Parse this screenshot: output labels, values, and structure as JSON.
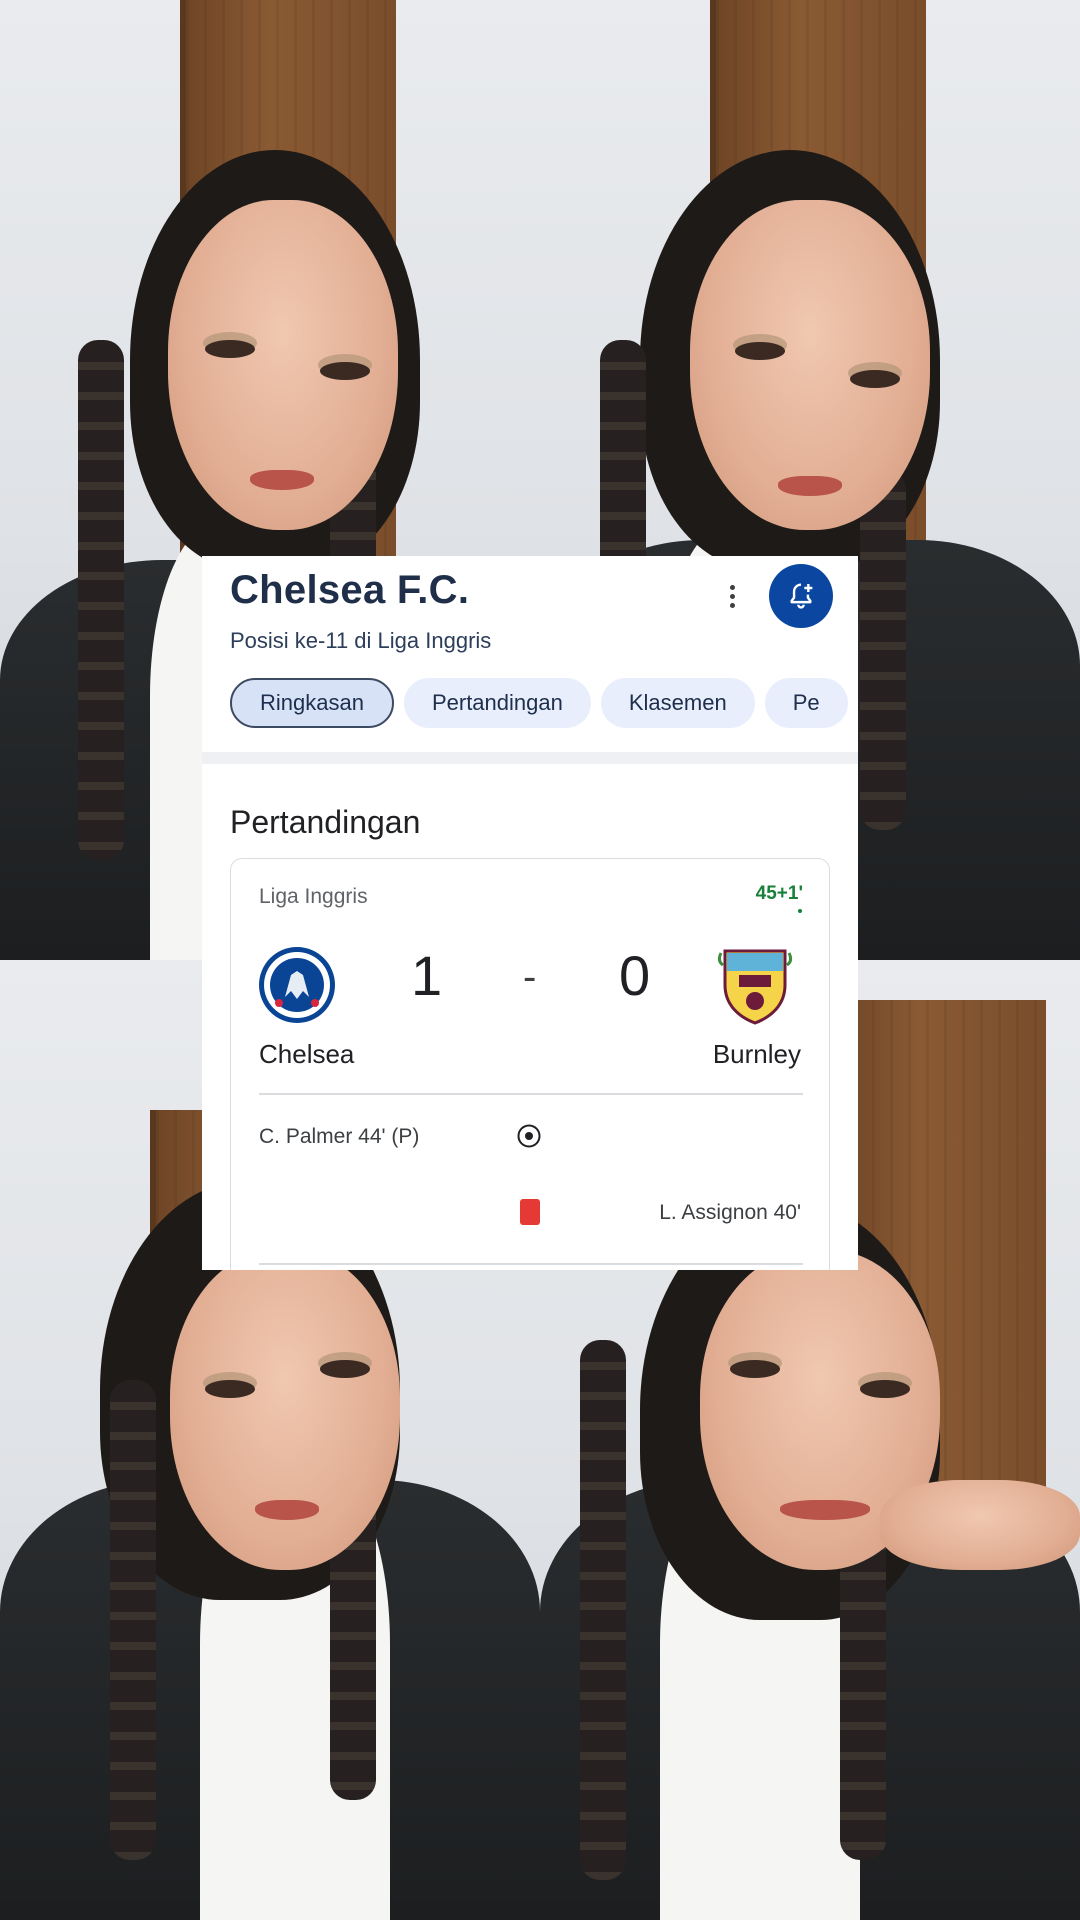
{
  "team_card": {
    "title": "Chelsea F.C.",
    "subtitle": "Posisi ke-11 di Liga Inggris",
    "menu_icon": "more-vert-icon",
    "follow_icon": "bell-plus-icon",
    "tabs": [
      {
        "label": "Ringkasan",
        "active": true
      },
      {
        "label": "Pertandingan",
        "active": false
      },
      {
        "label": "Klasemen",
        "active": false
      },
      {
        "label": "Pe",
        "active": false
      }
    ],
    "section_title": "Pertandingan",
    "match": {
      "league": "Liga Inggris",
      "minute": "45+1'",
      "home": {
        "name": "Chelsea",
        "score": "1",
        "crest_icon": "chelsea-crest-icon"
      },
      "away": {
        "name": "Burnley",
        "score": "0",
        "crest_icon": "burnley-crest-icon"
      },
      "separator": "-",
      "events": [
        {
          "side": "home",
          "text": "C. Palmer 44' (P)",
          "icon": "soccer-ball-icon"
        },
        {
          "side": "away",
          "text": "L. Assignon 40'",
          "icon": "red-card-icon"
        }
      ]
    },
    "colors": {
      "accent": "#0b47a1",
      "tab_bg": "#e8eefb",
      "live_green": "#188038",
      "red_card": "#e53935"
    }
  }
}
